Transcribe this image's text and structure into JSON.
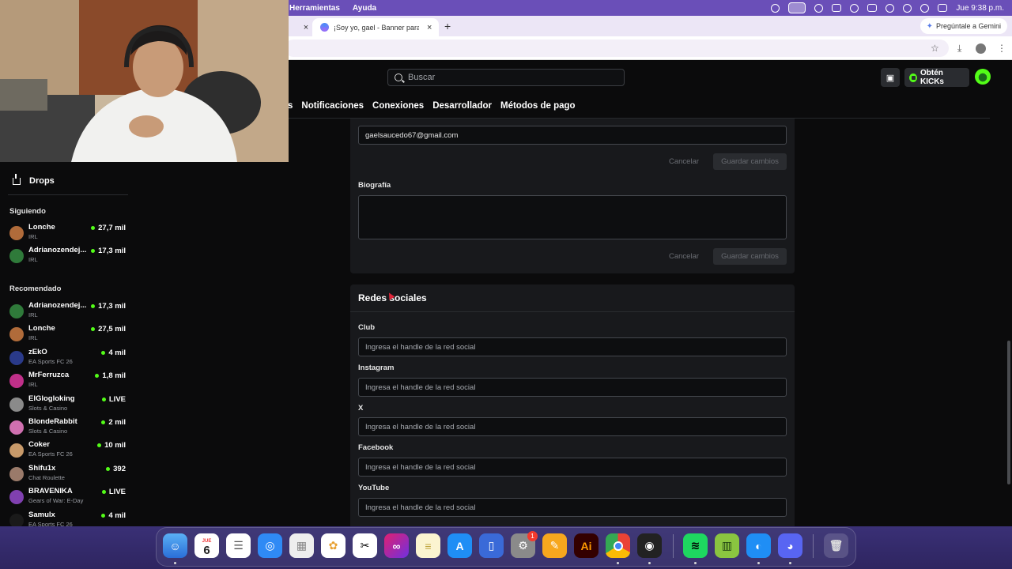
{
  "menubar": {
    "items": [
      "Herramientas",
      "Ayuda"
    ],
    "clock": "Jue 9:38 p.m."
  },
  "browser": {
    "active_tab": "¡Soy yo, gael - Banner para Y",
    "gemini_button": "Pregúntale a Gemini"
  },
  "header": {
    "search_placeholder": "Buscar",
    "kicks_button": "Obtén KICKs"
  },
  "settings_tabs": [
    "s",
    "Notificaciones",
    "Conexiones",
    "Desarrollador",
    "Métodos de pago"
  ],
  "sidebar": {
    "drops_label": "Drops",
    "following_title": "Siguiendo",
    "following": [
      {
        "name": "Lonche",
        "category": "IRL",
        "viewers": "27,7 mil",
        "avatar_color": "#b06b3a"
      },
      {
        "name": "Adrianozendej...",
        "category": "IRL",
        "viewers": "17,3 mil",
        "avatar_color": "#2f7a3a"
      }
    ],
    "recommended_title": "Recomendado",
    "recommended": [
      {
        "name": "Adrianozendej...",
        "category": "IRL",
        "viewers": "17,3 mil",
        "avatar_color": "#2f7a3a"
      },
      {
        "name": "Lonche",
        "category": "IRL",
        "viewers": "27,5 mil",
        "avatar_color": "#b06b3a"
      },
      {
        "name": "zEkO",
        "category": "EA Sports FC 26",
        "viewers": "4 mil",
        "avatar_color": "#2a3a8a"
      },
      {
        "name": "MrFerruzca",
        "category": "IRL",
        "viewers": "1,8 mil",
        "avatar_color": "#c0308a"
      },
      {
        "name": "ElGlogloking",
        "category": "Slots & Casino",
        "viewers": "LIVE",
        "avatar_color": "#8a8a8a"
      },
      {
        "name": "BlondeRabbit",
        "category": "Slots & Casino",
        "viewers": "2 mil",
        "avatar_color": "#d070b0"
      },
      {
        "name": "Coker",
        "category": "EA Sports FC 26",
        "viewers": "10 mil",
        "avatar_color": "#c89a6a"
      },
      {
        "name": "Shifu1x",
        "category": "Chat Roulette",
        "viewers": "392",
        "avatar_color": "#9a7a6a"
      },
      {
        "name": "BRAVENIKA",
        "category": "Gears of War: E-Day",
        "viewers": "LIVE",
        "avatar_color": "#8040b0"
      },
      {
        "name": "Samulx",
        "category": "EA Sports FC 26",
        "viewers": "4 mil",
        "avatar_color": "#1a1a1a"
      }
    ]
  },
  "profile": {
    "email_value": "gaelsaucedo67@gmail.com",
    "cancel_label": "Cancelar",
    "save_label": "Guardar cambios",
    "bio_label": "Biografía"
  },
  "social": {
    "title": "Redes sociales",
    "placeholder": "Ingresa el handle de la red social",
    "fields": [
      "Club",
      "Instagram",
      "X",
      "Facebook",
      "YouTube"
    ]
  },
  "dock": {
    "calendar_month": "JUE",
    "calendar_day": "6",
    "settings_badge": "1"
  },
  "colors": {
    "kick_green": "#53fc18",
    "menubar_purple": "#6a4fb8",
    "panel_bg": "#18191c"
  }
}
